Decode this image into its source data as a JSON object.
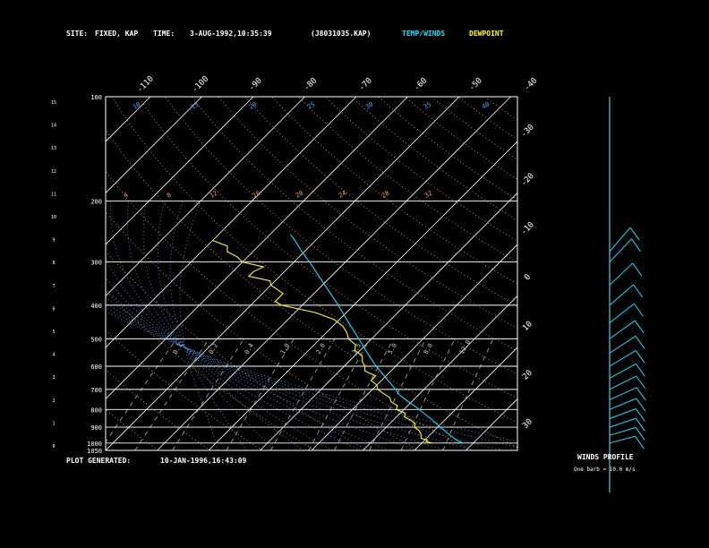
{
  "header": {
    "site_label": "SITE:",
    "site_value": "FIXED, KAP",
    "time_label": "TIME:",
    "time_value": "3-AUG-1992,10:35:39",
    "file_name": "(J8031035.KAP)",
    "temp_winds_label": "TEMP/WINDS",
    "dewpoint_label": "DEWPOINT"
  },
  "footer": {
    "generated_label": "PLOT GENERATED:",
    "generated_value": "10-JAN-1996,16:43:09"
  },
  "winds_panel": {
    "title": "WINDS PROFILE",
    "subtitle": "One barb = 10.0 m/s"
  },
  "colors": {
    "background": "#000000",
    "frame": "#ffffff",
    "temp_line": "#00e5ff",
    "dewpoint_line": "#ffff00",
    "dry_adiabat": "#f0a060",
    "moist_adiabat": "#5aa0ff",
    "mixing_ratio": "#a0a0a0"
  },
  "chart_data": {
    "type": "line",
    "title": "",
    "pressure_levels": [
      100,
      200,
      300,
      400,
      500,
      600,
      700,
      800,
      900,
      1000,
      1050
    ],
    "pressure_ticks": [
      "100",
      "200",
      "300",
      "400",
      "500",
      "600",
      "700",
      "800",
      "900",
      "1000",
      "1050"
    ],
    "height_ticks": [
      "15",
      "14",
      "13",
      "12",
      "11",
      "10",
      "9",
      "8",
      "7",
      "6",
      "5",
      "4",
      "3",
      "2",
      "1",
      "0"
    ],
    "top_temp_labels": [
      "-110",
      "-100",
      "-90",
      "-80",
      "-70",
      "-60",
      "-50",
      "-40"
    ],
    "right_temp_labels": [
      "-30",
      "-20",
      "-10",
      "0",
      "10",
      "20",
      "30"
    ],
    "dry_adiabat_labels": [
      "4",
      "8",
      "12",
      "16",
      "20",
      "24",
      "28",
      "32"
    ],
    "moist_adiabat_labels": [
      "10",
      "15",
      "20",
      "25",
      "30",
      "35",
      "40"
    ],
    "mixing_ratio_labels": [
      "0.1",
      "0.2",
      "0.4",
      "1.0",
      "2.0",
      "3.5",
      "5.0",
      "8.0",
      "12.0"
    ],
    "series": [
      {
        "name": "TEMP/WINDS",
        "values": [
          [
            1000,
            28.0
          ],
          [
            990,
            27.0
          ],
          [
            975,
            25.8
          ],
          [
            950,
            24.0
          ],
          [
            925,
            22.3
          ],
          [
            900,
            20.5
          ],
          [
            875,
            18.8
          ],
          [
            850,
            17.0
          ],
          [
            825,
            15.0
          ],
          [
            800,
            13.0
          ],
          [
            775,
            10.8
          ],
          [
            750,
            8.5
          ],
          [
            725,
            6.2
          ],
          [
            700,
            4.5
          ],
          [
            650,
            0.5
          ],
          [
            600,
            -3.8
          ],
          [
            550,
            -8.0
          ],
          [
            500,
            -12.5
          ],
          [
            450,
            -17.5
          ],
          [
            400,
            -23.0
          ],
          [
            350,
            -29.5
          ],
          [
            300,
            -37.0
          ],
          [
            280,
            -40.5
          ],
          [
            260,
            -44.0
          ],
          [
            250,
            -46.0
          ]
        ]
      },
      {
        "name": "DEWPOINT",
        "values": [
          [
            1000,
            22.0
          ],
          [
            990,
            20.5
          ],
          [
            980,
            20.5
          ],
          [
            970,
            19.0
          ],
          [
            955,
            18.5
          ],
          [
            940,
            18.0
          ],
          [
            920,
            17.0
          ],
          [
            900,
            15.5
          ],
          [
            880,
            15.0
          ],
          [
            860,
            13.5
          ],
          [
            840,
            11.5
          ],
          [
            820,
            11.0
          ],
          [
            800,
            8.5
          ],
          [
            780,
            8.0
          ],
          [
            760,
            6.0
          ],
          [
            740,
            5.0
          ],
          [
            720,
            3.0
          ],
          [
            700,
            1.0
          ],
          [
            680,
            0.0
          ],
          [
            660,
            -2.0
          ],
          [
            640,
            -2.0
          ],
          [
            620,
            -5.0
          ],
          [
            600,
            -6.0
          ],
          [
            580,
            -7.5
          ],
          [
            560,
            -8.5
          ],
          [
            540,
            -11.0
          ],
          [
            520,
            -12.0
          ],
          [
            500,
            -14.5
          ],
          [
            480,
            -16.0
          ],
          [
            460,
            -18.0
          ],
          [
            440,
            -21.0
          ],
          [
            420,
            -26.0
          ],
          [
            400,
            -34.0
          ],
          [
            390,
            -36.0
          ],
          [
            370,
            -36.0
          ],
          [
            350,
            -40.0
          ],
          [
            340,
            -41.0
          ],
          [
            330,
            -46.0
          ],
          [
            320,
            -46.0
          ],
          [
            310,
            -45.0
          ],
          [
            300,
            -50.0
          ],
          [
            290,
            -52.0
          ],
          [
            280,
            -55.0
          ],
          [
            270,
            -56.0
          ],
          [
            260,
            -60.0
          ]
        ]
      }
    ],
    "wind_barbs": [
      [
        1000,
        5
      ],
      [
        950,
        8
      ],
      [
        900,
        10
      ],
      [
        850,
        12
      ],
      [
        800,
        15
      ],
      [
        750,
        18
      ],
      [
        700,
        20
      ],
      [
        650,
        22
      ],
      [
        600,
        25
      ],
      [
        550,
        28
      ],
      [
        500,
        30
      ],
      [
        450,
        32
      ],
      [
        400,
        35
      ],
      [
        350,
        38
      ],
      [
        300,
        40
      ],
      [
        280,
        42
      ]
    ],
    "xlim": [
      -40,
      40
    ],
    "log_pressure": true,
    "grid": true
  }
}
